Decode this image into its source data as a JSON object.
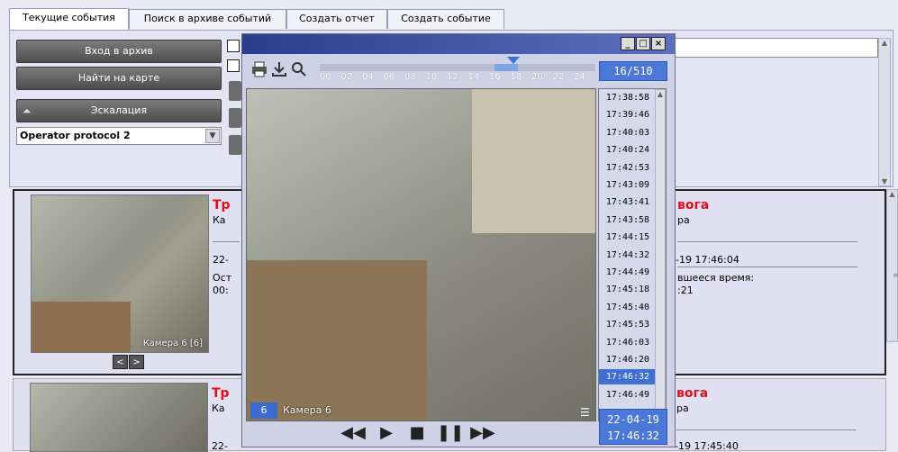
{
  "tabs": [
    "Текущие события",
    "Поиск в архиве событий",
    "Создать отчет",
    "Создать событие"
  ],
  "panel": {
    "archive_button": "Вход в архив",
    "map_button": "Найти на карте",
    "escalation_button": "Эскалация",
    "protocol_select": "Operator protocol 2"
  },
  "events": [
    {
      "alarm": "Тревога",
      "camera": "Камера",
      "date": "22-04-19 17:46:04",
      "left_date": "22-",
      "rest_label": "Оставшееся время:",
      "rest_value": "00:00:21",
      "rest_left": "Ост",
      "rest_left2": "00:",
      "thumb_caption": "Камера 6 [6]"
    },
    {
      "alarm": "Тревога",
      "camera": "Камера",
      "date": "22-04-19 17:45:40",
      "left_date": "22-"
    }
  ],
  "right_fragments": {
    "alarm1": "вога",
    "camera1": "ра",
    "date1": "-19 17:46:04",
    "rest_label": "вшееся время:",
    "rest_value": ":21",
    "alarm2": "вога",
    "camera2": "ра",
    "date2": "-19 17:45:40"
  },
  "player": {
    "counter": "16/510",
    "hours": [
      "00",
      "02",
      "04",
      "06",
      "08",
      "10",
      "12",
      "14",
      "16",
      "18",
      "20",
      "22",
      "24"
    ],
    "times": [
      "17:38:58",
      "17:39:46",
      "17:40:03",
      "17:40:24",
      "17:42:53",
      "17:43:09",
      "17:43:41",
      "17:43:58",
      "17:44:15",
      "17:44:32",
      "17:44:49",
      "17:45:18",
      "17:45:40",
      "17:45:53",
      "17:46:03",
      "17:46:20",
      "17:46:32",
      "17:46:49"
    ],
    "selected_time": "17:46:32",
    "camera_number": "6",
    "camera_label": "Камера 6",
    "date": "22-04-19",
    "time": "17:46:32",
    "window_buttons": [
      "_",
      "□",
      "×"
    ]
  },
  "icons": {
    "print": "print-icon",
    "download": "download-icon",
    "zoom": "zoom-icon",
    "rewind": "◀◀",
    "play": "▶",
    "stop": "■",
    "pause": "❚❚",
    "forward": "▶▶"
  }
}
